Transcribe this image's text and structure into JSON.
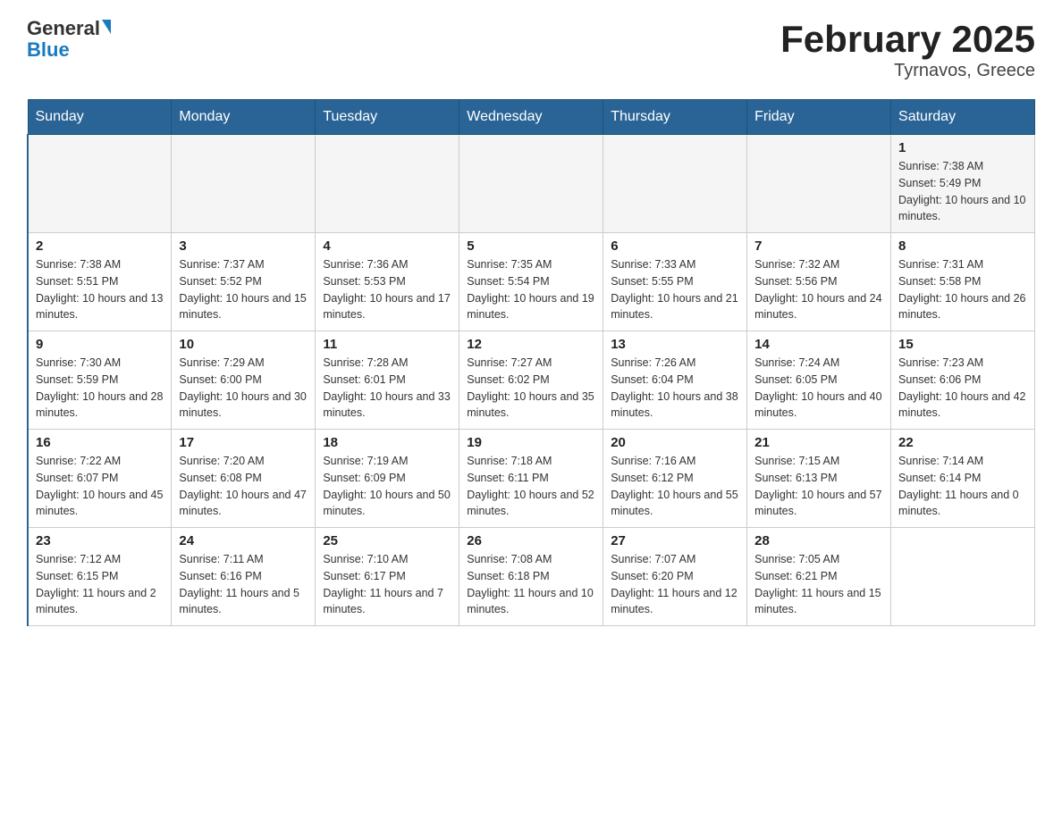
{
  "header": {
    "logo_general": "General",
    "logo_blue": "Blue",
    "title": "February 2025",
    "subtitle": "Tyrnavos, Greece"
  },
  "days_of_week": [
    "Sunday",
    "Monday",
    "Tuesday",
    "Wednesday",
    "Thursday",
    "Friday",
    "Saturday"
  ],
  "weeks": [
    [
      {
        "day": "",
        "info": ""
      },
      {
        "day": "",
        "info": ""
      },
      {
        "day": "",
        "info": ""
      },
      {
        "day": "",
        "info": ""
      },
      {
        "day": "",
        "info": ""
      },
      {
        "day": "",
        "info": ""
      },
      {
        "day": "1",
        "info": "Sunrise: 7:38 AM\nSunset: 5:49 PM\nDaylight: 10 hours and 10 minutes."
      }
    ],
    [
      {
        "day": "2",
        "info": "Sunrise: 7:38 AM\nSunset: 5:51 PM\nDaylight: 10 hours and 13 minutes."
      },
      {
        "day": "3",
        "info": "Sunrise: 7:37 AM\nSunset: 5:52 PM\nDaylight: 10 hours and 15 minutes."
      },
      {
        "day": "4",
        "info": "Sunrise: 7:36 AM\nSunset: 5:53 PM\nDaylight: 10 hours and 17 minutes."
      },
      {
        "day": "5",
        "info": "Sunrise: 7:35 AM\nSunset: 5:54 PM\nDaylight: 10 hours and 19 minutes."
      },
      {
        "day": "6",
        "info": "Sunrise: 7:33 AM\nSunset: 5:55 PM\nDaylight: 10 hours and 21 minutes."
      },
      {
        "day": "7",
        "info": "Sunrise: 7:32 AM\nSunset: 5:56 PM\nDaylight: 10 hours and 24 minutes."
      },
      {
        "day": "8",
        "info": "Sunrise: 7:31 AM\nSunset: 5:58 PM\nDaylight: 10 hours and 26 minutes."
      }
    ],
    [
      {
        "day": "9",
        "info": "Sunrise: 7:30 AM\nSunset: 5:59 PM\nDaylight: 10 hours and 28 minutes."
      },
      {
        "day": "10",
        "info": "Sunrise: 7:29 AM\nSunset: 6:00 PM\nDaylight: 10 hours and 30 minutes."
      },
      {
        "day": "11",
        "info": "Sunrise: 7:28 AM\nSunset: 6:01 PM\nDaylight: 10 hours and 33 minutes."
      },
      {
        "day": "12",
        "info": "Sunrise: 7:27 AM\nSunset: 6:02 PM\nDaylight: 10 hours and 35 minutes."
      },
      {
        "day": "13",
        "info": "Sunrise: 7:26 AM\nSunset: 6:04 PM\nDaylight: 10 hours and 38 minutes."
      },
      {
        "day": "14",
        "info": "Sunrise: 7:24 AM\nSunset: 6:05 PM\nDaylight: 10 hours and 40 minutes."
      },
      {
        "day": "15",
        "info": "Sunrise: 7:23 AM\nSunset: 6:06 PM\nDaylight: 10 hours and 42 minutes."
      }
    ],
    [
      {
        "day": "16",
        "info": "Sunrise: 7:22 AM\nSunset: 6:07 PM\nDaylight: 10 hours and 45 minutes."
      },
      {
        "day": "17",
        "info": "Sunrise: 7:20 AM\nSunset: 6:08 PM\nDaylight: 10 hours and 47 minutes."
      },
      {
        "day": "18",
        "info": "Sunrise: 7:19 AM\nSunset: 6:09 PM\nDaylight: 10 hours and 50 minutes."
      },
      {
        "day": "19",
        "info": "Sunrise: 7:18 AM\nSunset: 6:11 PM\nDaylight: 10 hours and 52 minutes."
      },
      {
        "day": "20",
        "info": "Sunrise: 7:16 AM\nSunset: 6:12 PM\nDaylight: 10 hours and 55 minutes."
      },
      {
        "day": "21",
        "info": "Sunrise: 7:15 AM\nSunset: 6:13 PM\nDaylight: 10 hours and 57 minutes."
      },
      {
        "day": "22",
        "info": "Sunrise: 7:14 AM\nSunset: 6:14 PM\nDaylight: 11 hours and 0 minutes."
      }
    ],
    [
      {
        "day": "23",
        "info": "Sunrise: 7:12 AM\nSunset: 6:15 PM\nDaylight: 11 hours and 2 minutes."
      },
      {
        "day": "24",
        "info": "Sunrise: 7:11 AM\nSunset: 6:16 PM\nDaylight: 11 hours and 5 minutes."
      },
      {
        "day": "25",
        "info": "Sunrise: 7:10 AM\nSunset: 6:17 PM\nDaylight: 11 hours and 7 minutes."
      },
      {
        "day": "26",
        "info": "Sunrise: 7:08 AM\nSunset: 6:18 PM\nDaylight: 11 hours and 10 minutes."
      },
      {
        "day": "27",
        "info": "Sunrise: 7:07 AM\nSunset: 6:20 PM\nDaylight: 11 hours and 12 minutes."
      },
      {
        "day": "28",
        "info": "Sunrise: 7:05 AM\nSunset: 6:21 PM\nDaylight: 11 hours and 15 minutes."
      },
      {
        "day": "",
        "info": ""
      }
    ]
  ]
}
